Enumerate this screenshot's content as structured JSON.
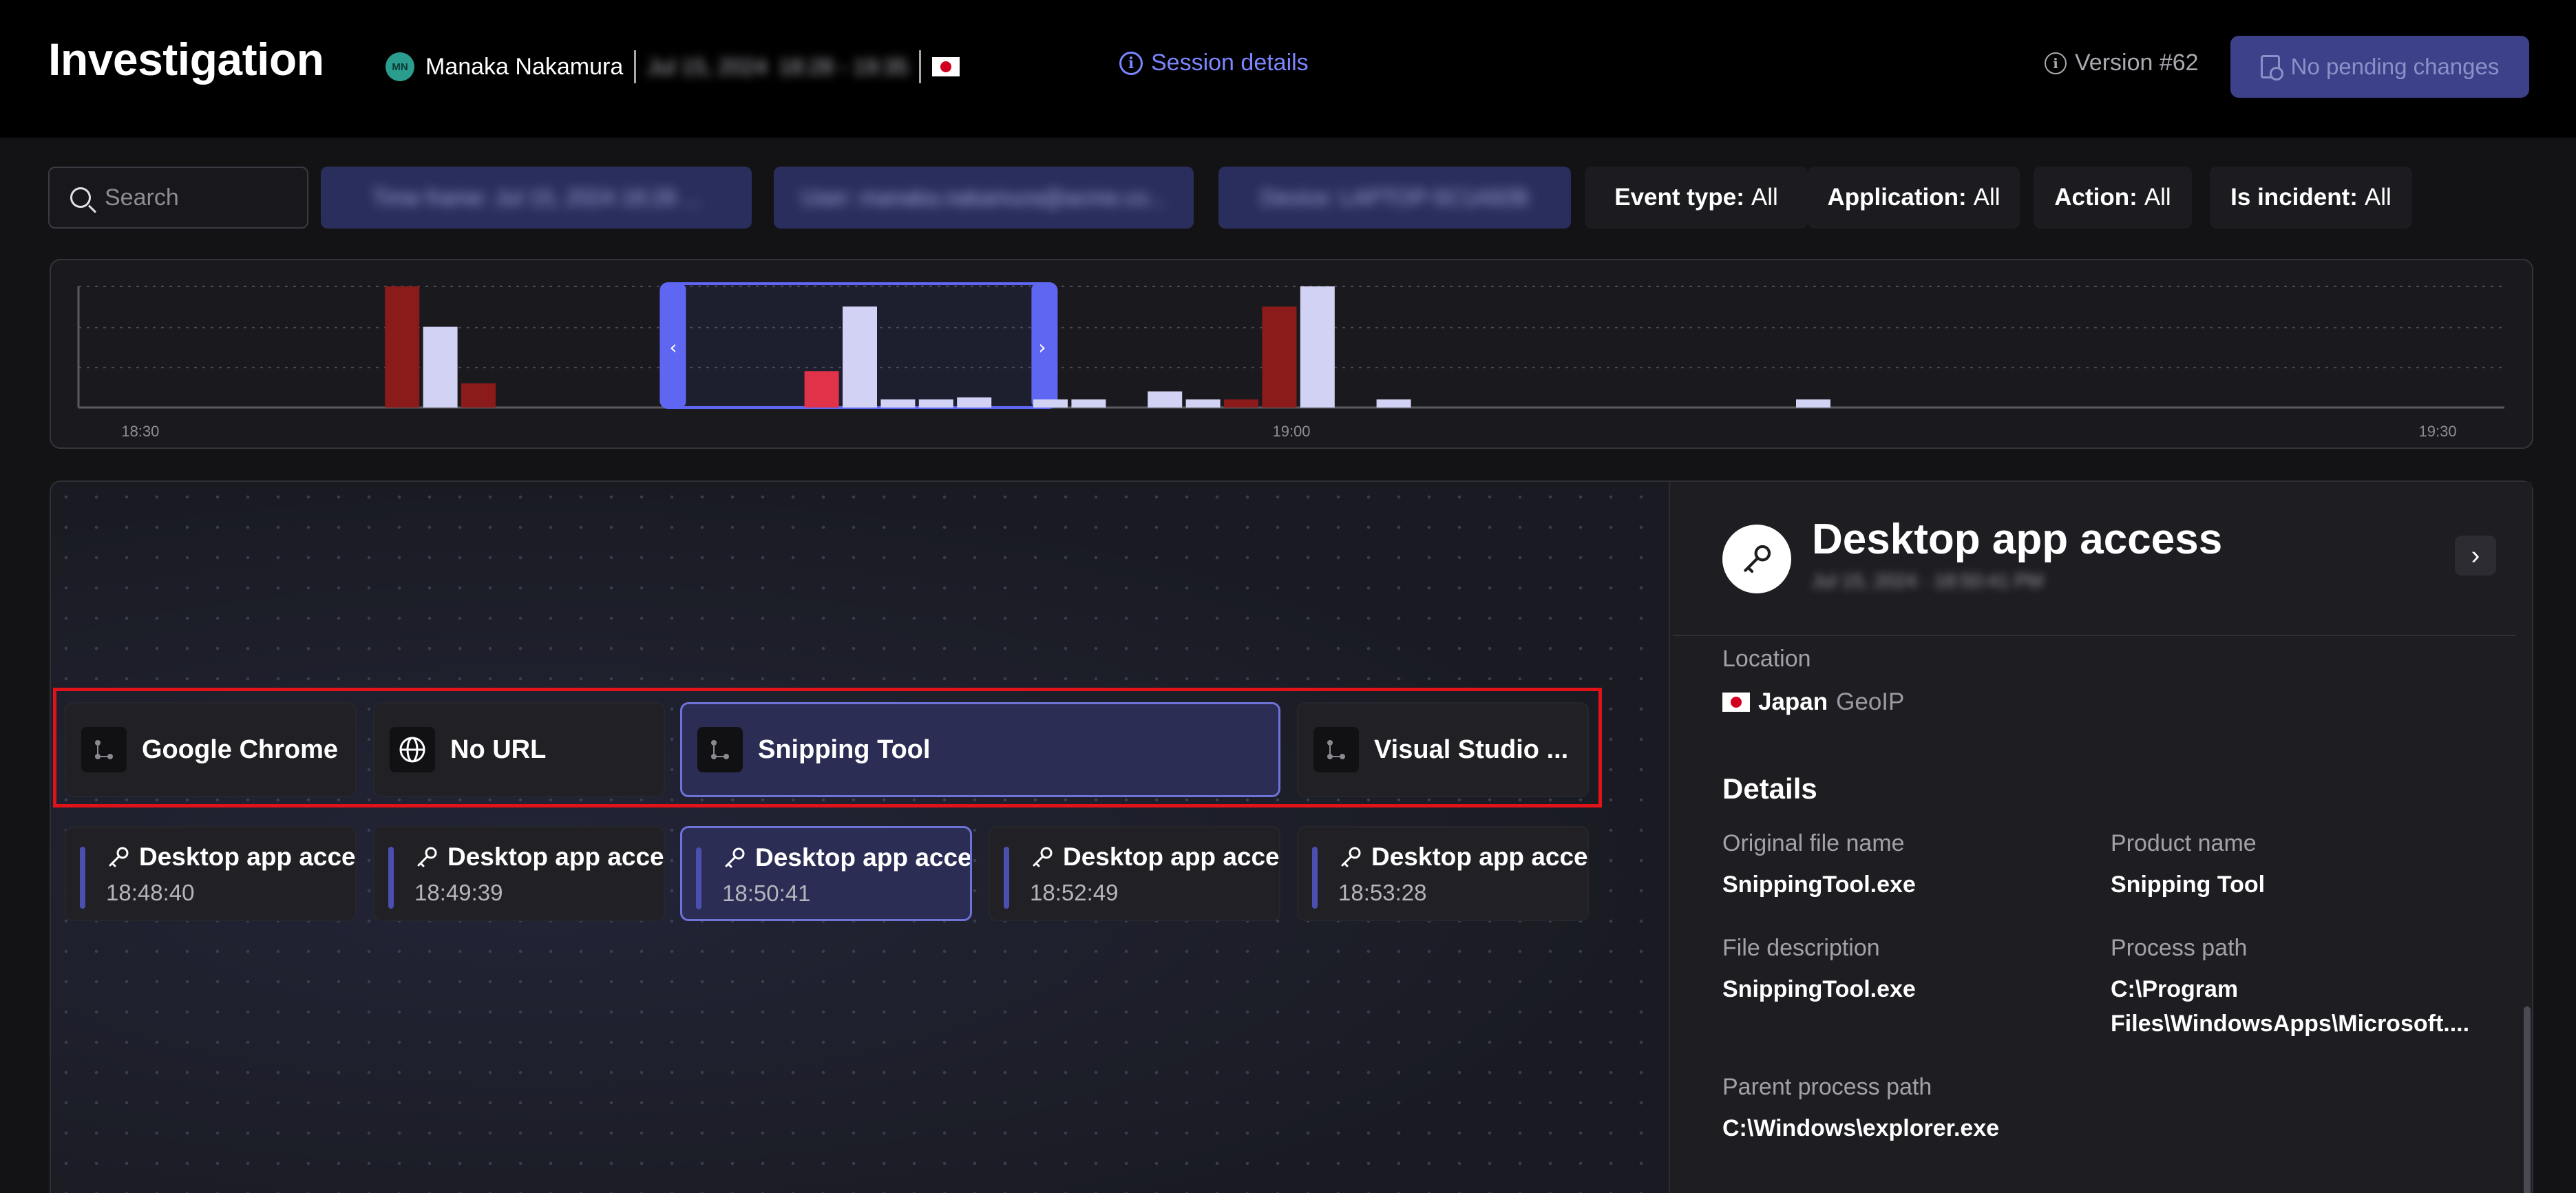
{
  "header": {
    "title": "Investigation",
    "user": {
      "initials": "MN",
      "name": "Manaka Nakamura"
    },
    "blurred_date": "Jul 15, 2024",
    "blurred_time": "18:28 - 19:35",
    "session_link": "Session details",
    "version": "Version #62",
    "pending_button": "No pending changes"
  },
  "filters": {
    "search_placeholder": "Search",
    "blurred": [
      "Time frame: Jul 15, 2024 18:28 ...",
      "User: manaka.nakamura@acme.co...",
      "Device: LAPTOP-5C1A92B"
    ],
    "chips": [
      {
        "key": "Event type:",
        "value": "All"
      },
      {
        "key": "Application:",
        "value": "All"
      },
      {
        "key": "Action:",
        "value": "All"
      },
      {
        "key": "Is incident:",
        "value": "All"
      }
    ]
  },
  "timeline": {
    "ticks": [
      "18:30",
      "19:00",
      "19:30"
    ]
  },
  "chart_data": {
    "type": "bar",
    "x_ticks": [
      "18:30",
      "19:00",
      "19:30"
    ],
    "series": [
      {
        "values": [
          0,
          0,
          0,
          0,
          0,
          0,
          0,
          0,
          3,
          2,
          0.6,
          0,
          0,
          0,
          0,
          0,
          0,
          0,
          0,
          0.9,
          2.5,
          0.2,
          0.2,
          0.25,
          0,
          0.2,
          0.2,
          0,
          0.4,
          0.2,
          0.2,
          2.5,
          3,
          0,
          0.2,
          0,
          0,
          0,
          0,
          0,
          0,
          0,
          0,
          0,
          0,
          0.2,
          0,
          0,
          0,
          0,
          0,
          0,
          0,
          0,
          0,
          0,
          0,
          0,
          0,
          0,
          0,
          0,
          0,
          0
        ]
      }
    ],
    "bar_colors": [
      "#8b1a1a",
      "#d9d9f7",
      "#8b1a1a",
      "#8b1a1a",
      "#e0334a",
      "#d2d2f5"
    ],
    "selection_range_bins": [
      16,
      26
    ],
    "ylim": [
      0,
      3
    ],
    "grid": true
  },
  "canvas": {
    "apps": [
      {
        "label": "Google Chrome",
        "icon": "app-node-icon"
      },
      {
        "label": "No URL",
        "icon": "globe-icon"
      },
      {
        "label": "Snipping Tool",
        "icon": "app-node-icon"
      },
      {
        "label": "Visual Studio ...",
        "icon": "app-node-icon"
      }
    ],
    "events": [
      {
        "title": "Desktop app acces",
        "time": "18:48:40"
      },
      {
        "title": "Desktop app acces",
        "time": "18:49:39"
      },
      {
        "title": "Desktop app acces",
        "time": "18:50:41"
      },
      {
        "title": "Desktop app acces",
        "time": "18:52:49"
      },
      {
        "title": "Desktop app acces",
        "time": "18:53:28"
      }
    ]
  },
  "panel": {
    "title": "Desktop app access",
    "subtitle_blurred": "Jul 15, 2024 · 18:50:41 PM",
    "location_label": "Location",
    "country": "Japan",
    "geo": "GeoIP",
    "details_heading": "Details",
    "fields": {
      "original_file_name_label": "Original file name",
      "original_file_name": "SnippingTool.exe",
      "product_name_label": "Product name",
      "product_name": "Snipping Tool",
      "file_description_label": "File description",
      "file_description": "SnippingTool.exe",
      "process_path_label": "Process path",
      "process_path": "C:\\Program Files\\WindowsApps\\Microsoft....",
      "parent_process_path_label": "Parent process path",
      "parent_process_path": "C:\\Windows\\explorer.exe"
    }
  },
  "colors": {
    "accent": "#7b86ff",
    "selection": "#5f66f2",
    "incident": "#8b1a1a",
    "highlight_box": "#e0131a"
  }
}
